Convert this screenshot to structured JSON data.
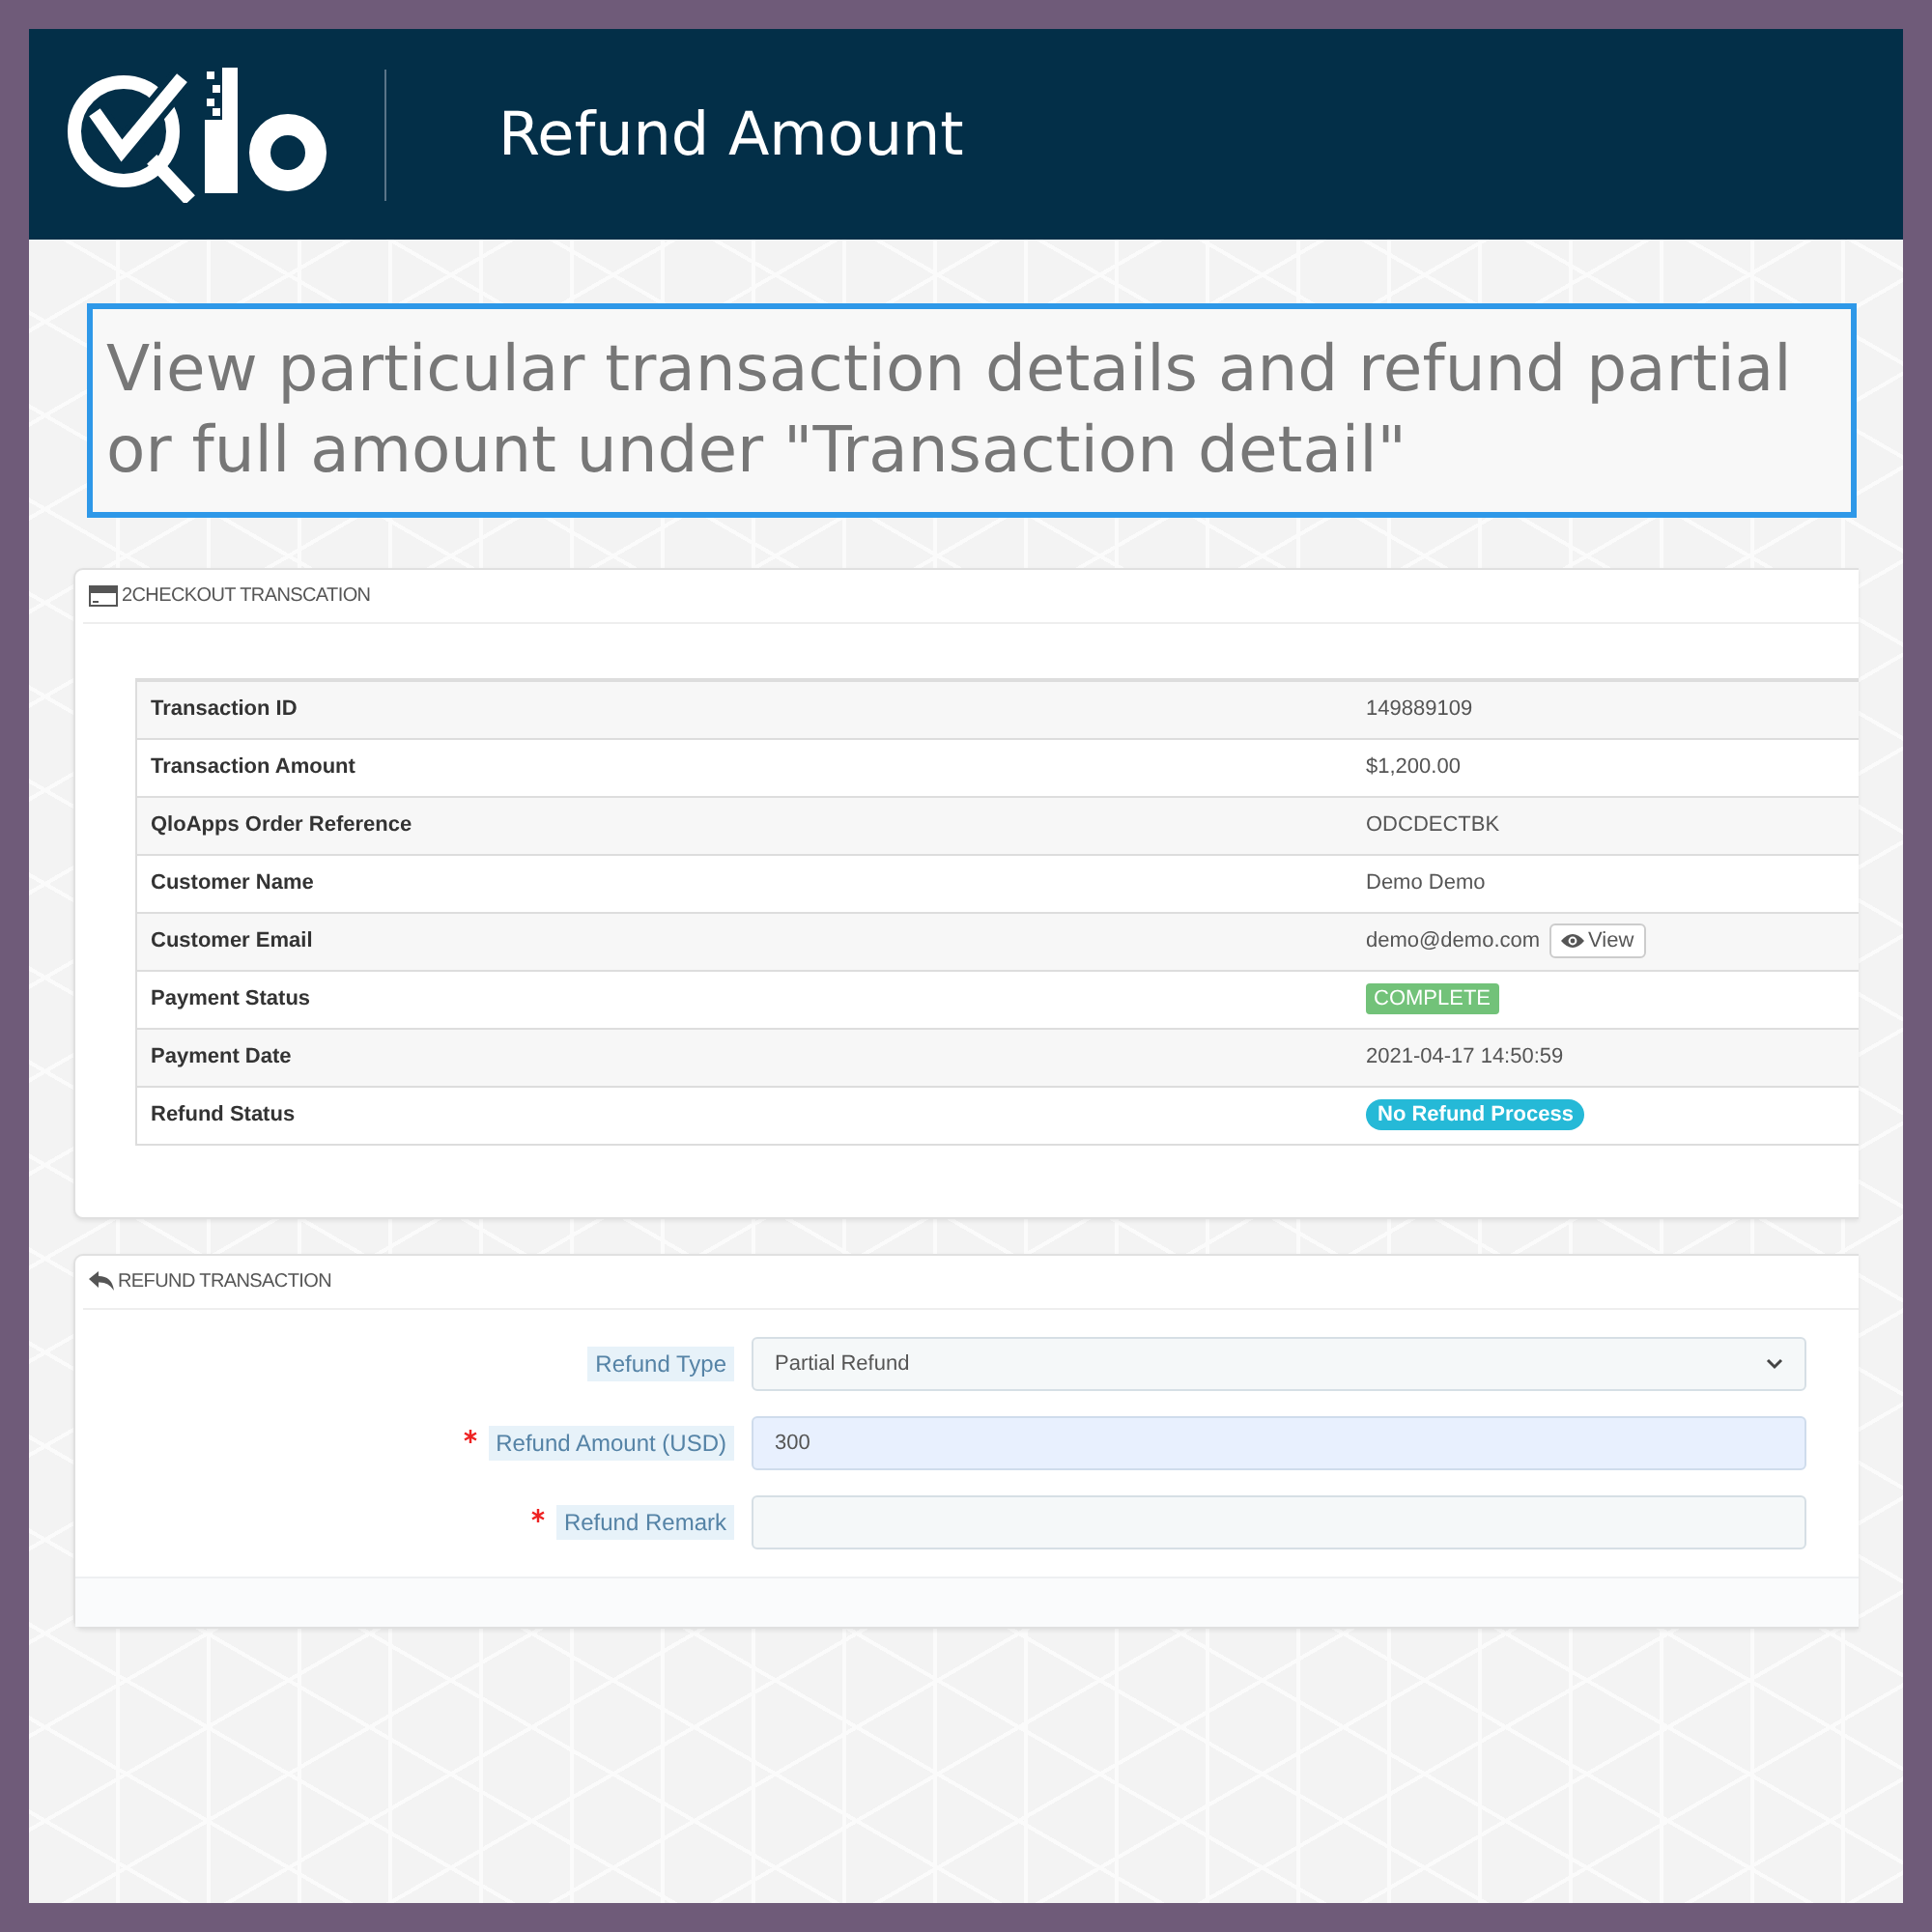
{
  "header": {
    "title": "Refund Amount"
  },
  "callout": {
    "text": "View particular transaction details and refund partial or full amount under \"Transaction detail\""
  },
  "transaction_panel": {
    "title": "2CHECKOUT TRANSCATION",
    "rows": [
      {
        "kind": "text",
        "label": "Transaction ID",
        "value": "149889109"
      },
      {
        "kind": "text",
        "label": "Transaction Amount",
        "value": "$1,200.00"
      },
      {
        "kind": "text",
        "label": "QloApps Order Reference",
        "value": "ODCDECTBK"
      },
      {
        "kind": "text",
        "label": "Customer Name",
        "value": "Demo Demo"
      },
      {
        "kind": "link",
        "label": "Customer Email",
        "value": "demo@demo.com",
        "button": "View"
      },
      {
        "kind": "badge",
        "label": "Payment Status",
        "value": "COMPLETE",
        "color": "#72c279"
      },
      {
        "kind": "text",
        "label": "Payment Date",
        "value": "2021-04-17 14:50:59"
      },
      {
        "kind": "pill",
        "label": "Refund Status",
        "value": "No Refund Process",
        "color": "#25b9d7"
      }
    ]
  },
  "refund_panel": {
    "title": "REFUND TRANSACTION",
    "fields": [
      {
        "kind": "select",
        "label": "Refund Type",
        "value": "Partial Refund",
        "required": false,
        "autofilled": false
      },
      {
        "kind": "input",
        "label": "Refund Amount (USD)",
        "value": "300",
        "required": true,
        "autofilled": true
      },
      {
        "kind": "input",
        "label": "Refund Remark",
        "required": true,
        "autofilled": false
      }
    ]
  }
}
